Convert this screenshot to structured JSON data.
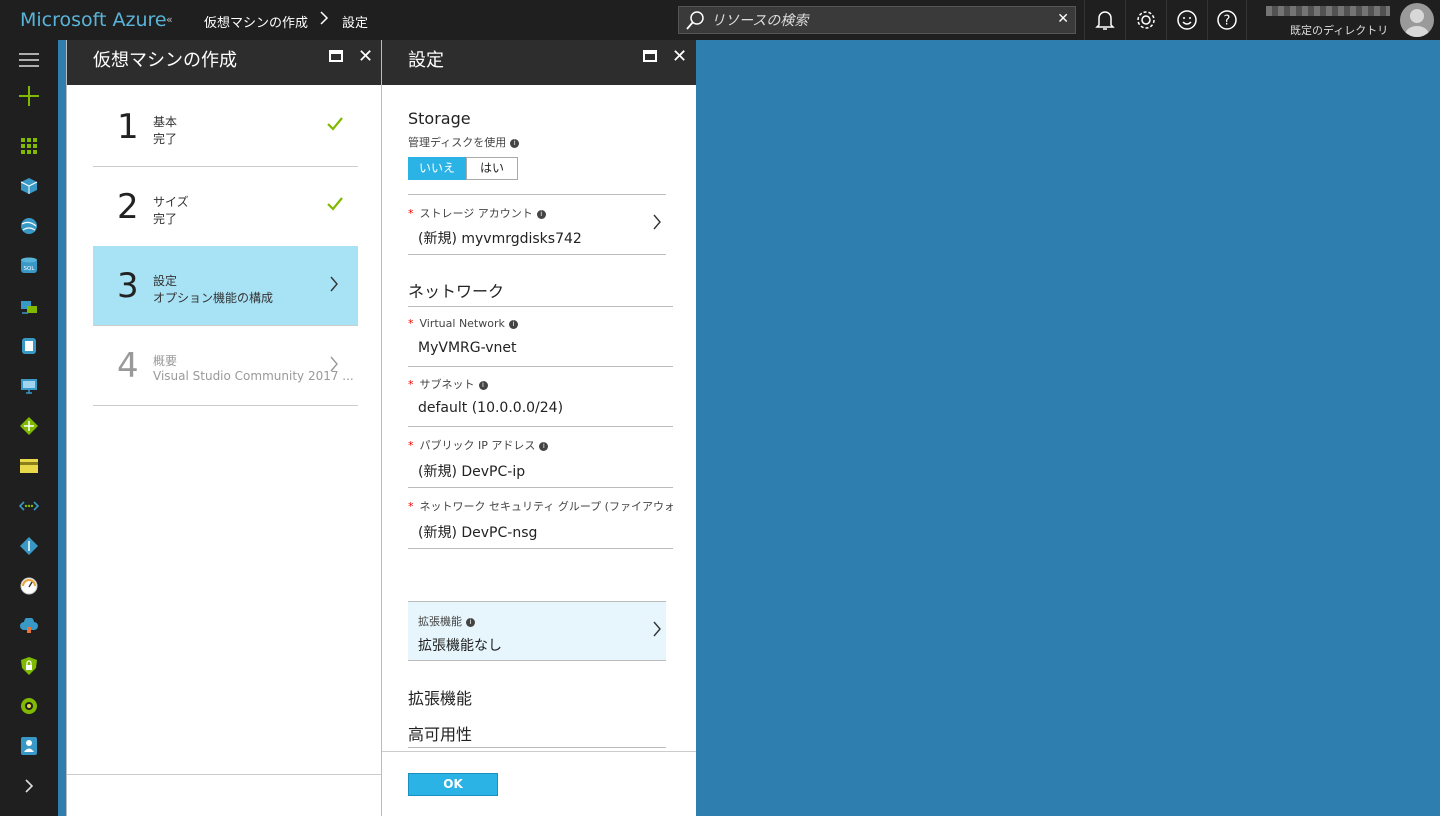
{
  "topbar": {
    "brand": "Microsoft Azure",
    "collapse": "«",
    "breadcrumb": [
      "仮想マシンの作成",
      "設定"
    ],
    "breadcrumb_sep": ">",
    "search_placeholder": "リソースの検索",
    "search_clear": "✕",
    "directory": "既定のディレクトリ"
  },
  "sidebar": {
    "items": [
      "menu",
      "new",
      "dashboard",
      "resource-groups",
      "app-services",
      "sql-databases",
      "virtual-machines-classic",
      "storage",
      "virtual-machines",
      "load-balancers",
      "subscriptions",
      "virtual-networks",
      "networking",
      "monitor",
      "cloud",
      "security-center",
      "cost",
      "advisor",
      "more"
    ],
    "more_label": "›"
  },
  "create_vm_blade": {
    "title": "仮想マシンの作成",
    "close": "✕",
    "steps": [
      {
        "number": "1",
        "title": "基本",
        "subtitle": "完了",
        "state": "done"
      },
      {
        "number": "2",
        "title": "サイズ",
        "subtitle": "完了",
        "state": "done"
      },
      {
        "number": "3",
        "title": "設定",
        "subtitle": "オプション機能の構成",
        "state": "active"
      },
      {
        "number": "4",
        "title": "概要",
        "subtitle": "Visual Studio Community 2017 ...",
        "state": "pending"
      }
    ]
  },
  "settings_blade": {
    "title": "設定",
    "close": "✕",
    "storage": {
      "heading": "Storage",
      "managed_disk_label": "管理ディスクを使用",
      "toggle_no": "いいえ",
      "toggle_yes": "はい",
      "storage_account_label": "ストレージ アカウント",
      "storage_account_value": "(新規) myvmrgdisks742"
    },
    "network": {
      "heading": "ネットワーク",
      "vnet_label": "Virtual Network",
      "vnet_value": "MyVMRG-vnet",
      "subnet_label": "サブネット",
      "subnet_value": "default (10.0.0.0/24)",
      "public_ip_label": "パブリック IP アドレス",
      "public_ip_value": "(新規) DevPC-ip",
      "nsg_label": "ネットワーク セキュリティ グループ (ファイアウォール)",
      "nsg_value": "(新規) DevPC-nsg"
    },
    "extensions": {
      "label": "拡張機能",
      "value": "拡張機能なし",
      "heading": "拡張機能"
    },
    "high_availability_heading": "高可用性",
    "ok_label": "OK",
    "required_mark": "*",
    "info_mark": "i"
  },
  "colors": {
    "brand_blue": "#59b4d9",
    "accent": "#2bb3e6",
    "active_step": "#a8e2f5",
    "background": "#2e7fb0",
    "check_green": "#7fba00"
  }
}
